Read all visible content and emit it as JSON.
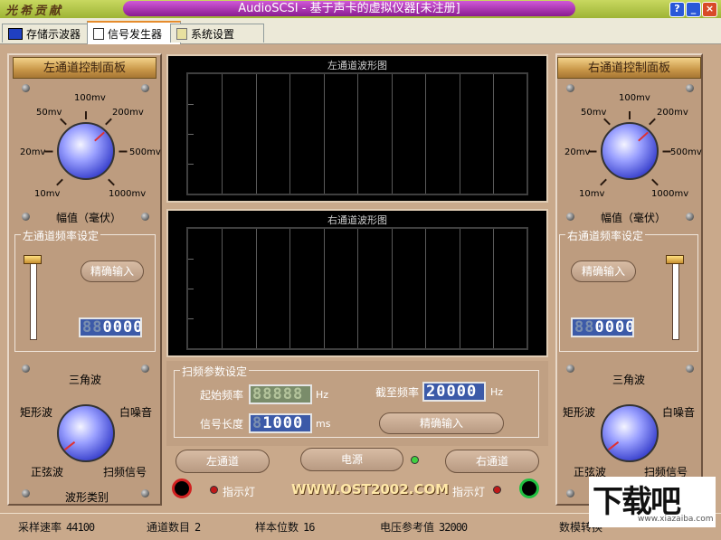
{
  "window": {
    "brand_text": "光希贡献",
    "title": "AudioSCSI - 基于声卡的虚拟仪器[未注册]",
    "btn_help": "?",
    "btn_min": "_",
    "btn_max": "□",
    "btn_close": "×"
  },
  "tabs": [
    {
      "label": "存储示波器"
    },
    {
      "label": "信号发生器",
      "active": true
    },
    {
      "label": "系统设置"
    }
  ],
  "left_panel": {
    "header": "左通道控制面板",
    "amp_labels": [
      "10mv",
      "20mv",
      "50mv",
      "100mv",
      "200mv",
      "500mv",
      "1000mv"
    ],
    "amp_caption": "幅值（毫伏）",
    "freq_group": "左通道频率设定",
    "precise_btn": "精确输入",
    "freq_display": "0000",
    "freq_display_dim": "88",
    "wave_labels": [
      "三角波",
      "矩形波",
      "白噪音",
      "正弦波",
      "扫频信号"
    ],
    "wave_caption": "波形类别"
  },
  "right_panel": {
    "header": "右通道控制面板",
    "amp_labels": [
      "10mv",
      "20mv",
      "50mv",
      "100mv",
      "200mv",
      "500mv",
      "1000mv"
    ],
    "amp_caption": "幅值（毫伏）",
    "freq_group": "右通道频率设定",
    "precise_btn": "精确输入",
    "freq_display": "0000",
    "freq_display_dim": "88",
    "wave_labels": [
      "三角波",
      "矩形波",
      "白噪音",
      "正弦波",
      "扫频信号"
    ]
  },
  "scopes": {
    "left_title": "左通道波形图",
    "right_title": "右通道波形图"
  },
  "sweep": {
    "group_title": "扫频参数设定",
    "start_label": "起始频率",
    "start_value": "88888",
    "start_unit": "Hz",
    "end_label": "截至频率",
    "end_value": "20000",
    "end_unit": "Hz",
    "length_label": "信号长度",
    "length_value": "1000",
    "length_dim": "8",
    "length_unit": "ms",
    "precise_btn": "精确输入"
  },
  "bottom": {
    "left_btn": "左通道",
    "power_btn": "电源",
    "right_btn": "右通道",
    "indicator_left": "指示灯",
    "indicator_right": "指示灯",
    "website": "WWW.OST2002.COM"
  },
  "status": {
    "sample_rate_label": "采样速率",
    "sample_rate": "44100",
    "channels_label": "通道数目",
    "channels": "2",
    "bits_label": "样本位数",
    "bits": "16",
    "vref_label": "电压参考值",
    "vref": "32000",
    "conv_label": "数模转换"
  },
  "watermark": {
    "text": "下载吧",
    "url": "www.xiazaiba.com"
  },
  "colors": {
    "panel": "#bd9c7f",
    "title_pill": "#a42aa8",
    "lcd": "#3c5aa8",
    "knob": "#3038c8"
  }
}
